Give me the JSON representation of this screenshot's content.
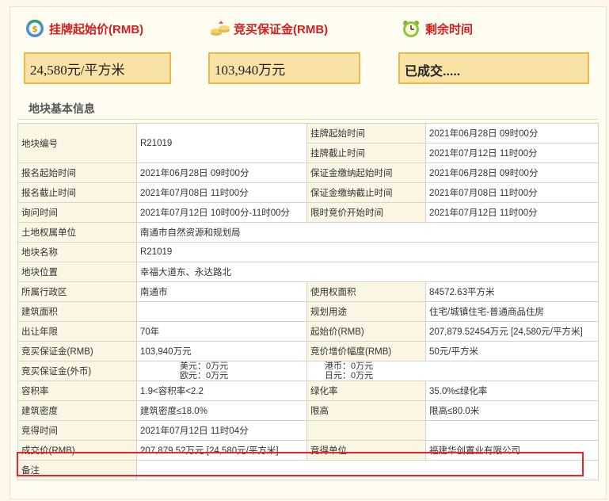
{
  "header": {
    "start_price_label": "挂牌起始价(RMB)",
    "deposit_label": "竞买保证金(RMB)",
    "remaining_label": "剩余时间",
    "start_price_value": "24,580元/平方米",
    "deposit_value": "103,940万元",
    "remaining_value": "已成交....."
  },
  "section_title": "地块基本信息",
  "colors": {
    "accent_red": "#d21f1f",
    "box_fill": "#f9e2a6",
    "box_border": "#f0b946",
    "highlight": "#e8252b"
  },
  "icons": {
    "start_price": "dollar-cycle-icon",
    "deposit": "coins-icon",
    "remaining": "alarm-clock-icon"
  },
  "table": {
    "parcel_no_label": "地块编号",
    "parcel_no": "R21019",
    "listing_start_label": "挂牌起始时间",
    "listing_start": "2021年06月28日 09时00分",
    "listing_end_label": "挂牌截止时间",
    "listing_end": "2021年07月12日 11时00分",
    "reg_start_label": "报名起始时间",
    "reg_start": "2021年06月28日 09时00分",
    "deposit_start_label": "保证金缴纳起始时间",
    "deposit_start": "2021年06月28日 09时00分",
    "reg_end_label": "报名截止时间",
    "reg_end": "2021年07月08日 11时00分",
    "deposit_end_label": "保证金缴纳截止时间",
    "deposit_end": "2021年07月08日 11时00分",
    "inquiry_label": "询问时间",
    "inquiry": "2021年07月12日 10时00分-11时00分",
    "timed_bid_label": "限时竞价开始时间",
    "timed_bid": "2021年07月12日 11时00分",
    "owner_label": "土地权属单位",
    "owner": "南通市自然资源和规划局",
    "name_label": "地块名称",
    "name": "R21019",
    "location_label": "地块位置",
    "location": "幸福大道东、永达路北",
    "district_label": "所属行政区",
    "district": "南通市",
    "use_area_label": "使用权面积",
    "use_area": "84572.63平方米",
    "build_area_label": "建筑面积",
    "build_area": "",
    "plan_use_label": "规划用途",
    "plan_use": "住宅/城镇住宅-普通商品住房",
    "term_label": "出让年限",
    "term": "70年",
    "start_price_label": "起始价(RMB)",
    "start_price": "207,879.52454万元 [24,580元/平方米]",
    "deposit_label": "竞买保证金(RMB)",
    "deposit": "103,940万元",
    "increment_label": "竞价增价幅度(RMB)",
    "increment": "50元/平方米",
    "foreign_deposit_label": "竞买保证金(外币)",
    "usd": "美元：0万元",
    "hkd": "港币：0万元",
    "eur": "欧元：0万元",
    "jpy": "日元：0万元",
    "far_label": "容积率",
    "far": "1.9<容积率<2.2",
    "green_label": "绿化率",
    "green": "35.0%≤绿化率",
    "density_label": "建筑密度",
    "density": "建筑密度≤18.0%",
    "height_label": "限高",
    "height": "限高≤80.0米",
    "win_time_label": "竞得时间",
    "win_time": "2021年07月12日 11时04分",
    "deal_price_label": "成交价(RMB)",
    "deal_price": "207,879.52万元 [24,580元/平方米]",
    "winner_label": "竞得单位",
    "winner": "福建华创置业有限公司",
    "remarks_label": "备注",
    "remarks": ""
  }
}
